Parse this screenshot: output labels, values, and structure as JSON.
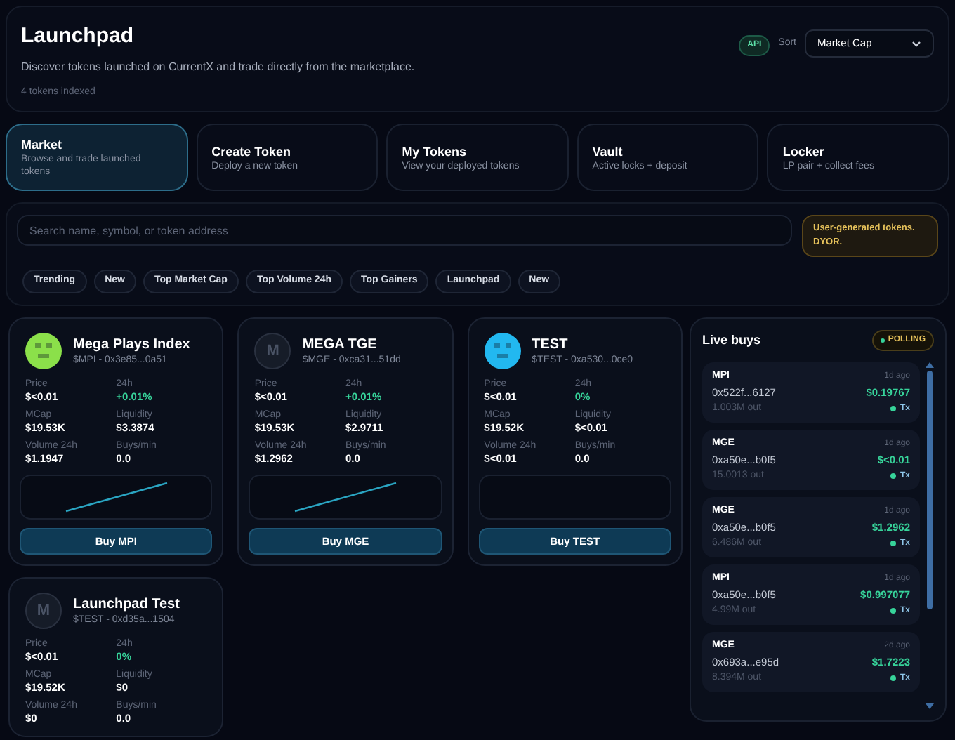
{
  "header": {
    "title": "Launchpad",
    "subtitle": "Discover tokens launched on CurrentX and trade directly from the marketplace.",
    "count": "4 tokens indexed",
    "badge": "API",
    "sort_label": "Sort",
    "sort_value": "Market Cap"
  },
  "tabs": [
    {
      "label": "Market",
      "description": "Browse and trade launched tokens",
      "selected": true
    },
    {
      "label": "Create Token",
      "description": "Deploy a new token",
      "selected": false
    },
    {
      "label": "My Tokens",
      "description": "View your deployed tokens",
      "selected": false
    },
    {
      "label": "Vault",
      "description": "Active locks + deposit",
      "selected": false
    },
    {
      "label": "Locker",
      "description": "LP pair + collect fees",
      "selected": false
    }
  ],
  "search": {
    "placeholder": "Search name, symbol, or token address"
  },
  "warning": "User-generated tokens. DYOR.",
  "filters": [
    "Trending",
    "New",
    "Top Market Cap",
    "Top Volume 24h",
    "Top Gainers",
    "Launchpad",
    "New"
  ],
  "tokens": [
    {
      "name": "Mega Plays Index",
      "subtitle": "$MPI - 0x3e85...0a51",
      "avatar": {
        "kind": "pixel",
        "color": "#8be04a"
      },
      "stats": [
        {
          "label": "Price",
          "value": "$<0.01"
        },
        {
          "label": "24h",
          "value": "+0.01%",
          "kind": "change"
        },
        {
          "label": "MCap",
          "value": "$19.53K"
        },
        {
          "label": "Liquidity",
          "value": "$3.3874"
        },
        {
          "label": "Volume 24h",
          "value": "$1.1947"
        },
        {
          "label": "Buys/min",
          "value": "0.0"
        }
      ],
      "sparkline": true,
      "button": "Buy MPI"
    },
    {
      "name": "MEGA TGE",
      "subtitle": "$MGE - 0xca31...51dd",
      "avatar": {
        "kind": "monogram",
        "letter": "M"
      },
      "stats": [
        {
          "label": "Price",
          "value": "$<0.01"
        },
        {
          "label": "24h",
          "value": "+0.01%",
          "kind": "change"
        },
        {
          "label": "MCap",
          "value": "$19.53K"
        },
        {
          "label": "Liquidity",
          "value": "$2.9711"
        },
        {
          "label": "Volume 24h",
          "value": "$1.2962"
        },
        {
          "label": "Buys/min",
          "value": "0.0"
        }
      ],
      "sparkline": true,
      "button": "Buy MGE"
    },
    {
      "name": "TEST",
      "subtitle": "$TEST - 0xa530...0ce0",
      "avatar": {
        "kind": "pixel",
        "color": "#22b8f0"
      },
      "stats": [
        {
          "label": "Price",
          "value": "$<0.01"
        },
        {
          "label": "24h",
          "value": "0%",
          "kind": "change"
        },
        {
          "label": "MCap",
          "value": "$19.52K"
        },
        {
          "label": "Liquidity",
          "value": "$<0.01"
        },
        {
          "label": "Volume 24h",
          "value": "$<0.01"
        },
        {
          "label": "Buys/min",
          "value": "0.0"
        }
      ],
      "sparkline": false,
      "button": "Buy TEST"
    },
    {
      "name": "Launchpad Test",
      "subtitle": "$TEST - 0xd35a...1504",
      "avatar": {
        "kind": "monogram",
        "letter": "M"
      },
      "stats": [
        {
          "label": "Price",
          "value": "$<0.01"
        },
        {
          "label": "24h",
          "value": "0%",
          "kind": "change"
        },
        {
          "label": "MCap",
          "value": "$19.52K"
        },
        {
          "label": "Liquidity",
          "value": "$0"
        },
        {
          "label": "Volume 24h",
          "value": "$0"
        },
        {
          "label": "Buys/min",
          "value": "0.0"
        }
      ]
    }
  ],
  "live_buys": {
    "title": "Live buys",
    "status": "POLLING",
    "items": [
      {
        "symbol": "MPI",
        "ago": "1d ago",
        "address": "0x522f...6127",
        "amount": "$0.19767",
        "out": "1.003M out",
        "link": "Tx"
      },
      {
        "symbol": "MGE",
        "ago": "1d ago",
        "address": "0xa50e...b0f5",
        "amount": "$<0.01",
        "out": "15.0013 out",
        "link": "Tx"
      },
      {
        "symbol": "MGE",
        "ago": "1d ago",
        "address": "0xa50e...b0f5",
        "amount": "$1.2962",
        "out": "6.486M out",
        "link": "Tx"
      },
      {
        "symbol": "MPI",
        "ago": "1d ago",
        "address": "0xa50e...b0f5",
        "amount": "$0.997077",
        "out": "4.99M out",
        "link": "Tx"
      },
      {
        "symbol": "MGE",
        "ago": "2d ago",
        "address": "0x693a...e95d",
        "amount": "$1.7223",
        "out": "8.394M out",
        "link": "Tx"
      }
    ]
  }
}
